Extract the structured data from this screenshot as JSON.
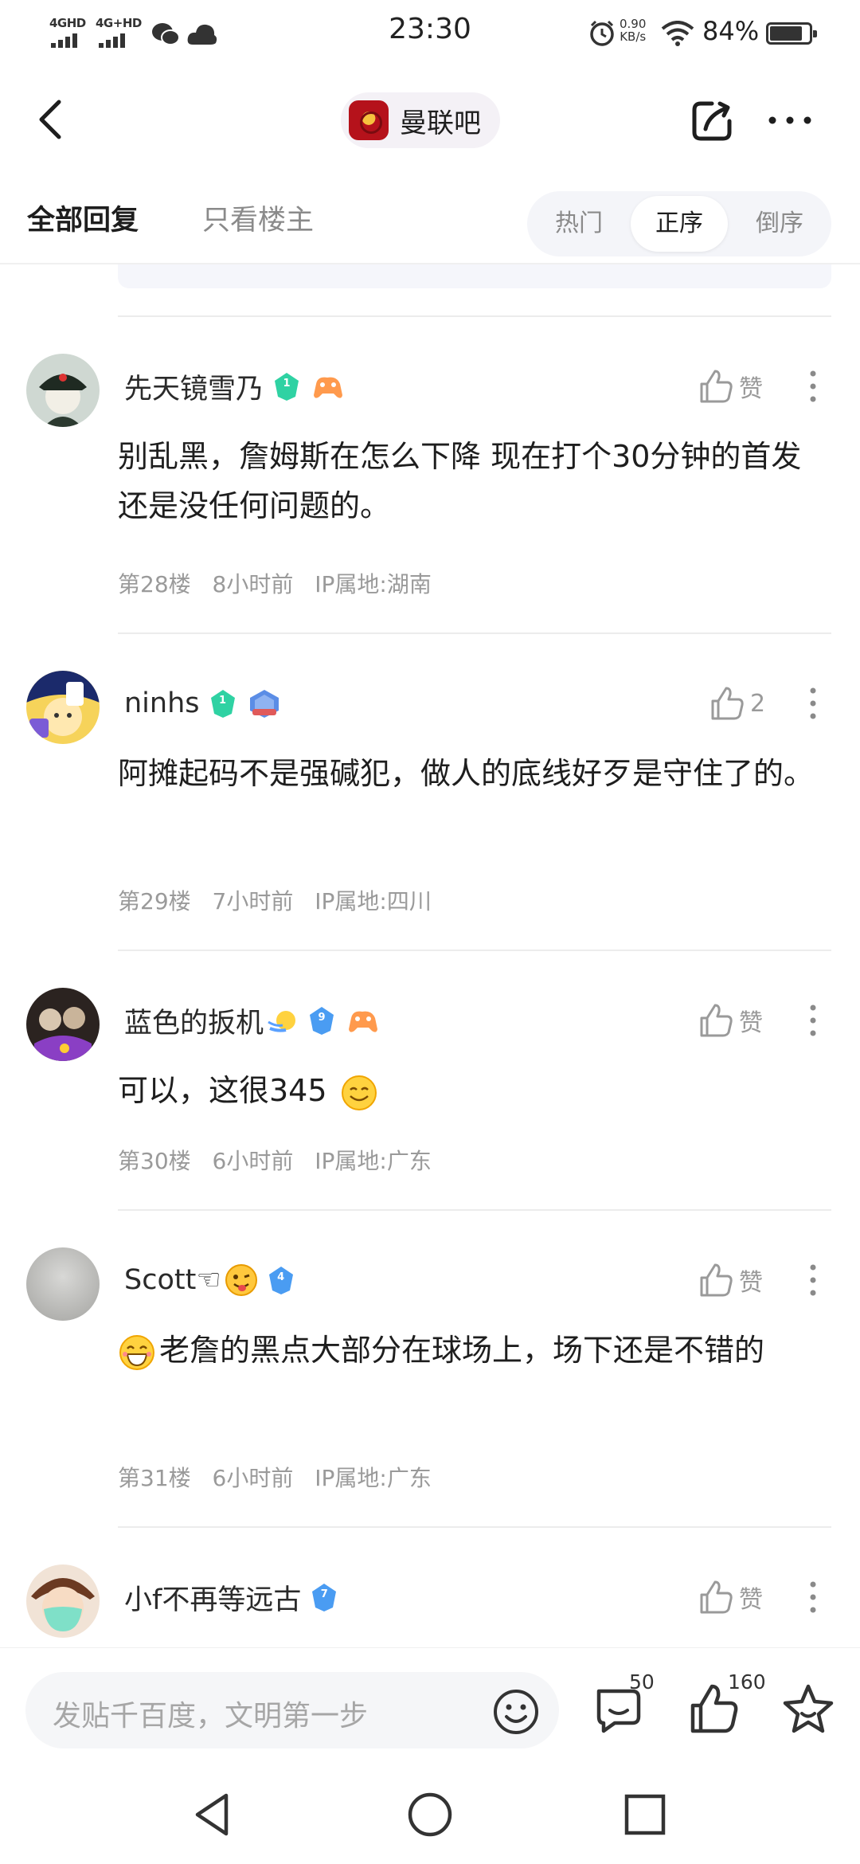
{
  "status_bar": {
    "sim1": "4GHD",
    "sim2": "4G+HD",
    "time": "23:30",
    "net_speed_value": "0.90",
    "net_speed_unit": "KB/s",
    "battery_pct": "84%",
    "battery_level": 0.84
  },
  "header": {
    "forum_name": "曼联吧"
  },
  "tabs": {
    "all_replies": "全部回复",
    "op_only": "只看楼主",
    "sort": [
      "热门",
      "正序",
      "倒序"
    ],
    "sort_selected": "正序"
  },
  "comments": [
    {
      "username": "先天镜雪乃",
      "level": "1",
      "level_color": "#2fd2a3",
      "content": "别乱黑，詹姆斯在怎么下降 现在打个30分钟的首发还是没任何问题的。",
      "floor": "第28楼",
      "time": "8小时前",
      "ip": "IP属地:湖南",
      "like": "赞"
    },
    {
      "username": "ninhs",
      "level": "1",
      "level_color": "#2fd2a3",
      "content": "阿摊起码不是强碱犯，做人的底线好歹是守住了的。",
      "floor": "第29楼",
      "time": "7小时前",
      "ip": "IP属地:四川",
      "like": "2"
    },
    {
      "username": "蓝色的扳机",
      "level": "9",
      "level_color": "#4a9cf2",
      "content": "可以，这很345",
      "floor": "第30楼",
      "time": "6小时前",
      "ip": "IP属地:广东",
      "like": "赞"
    },
    {
      "username": "Scott☜",
      "level": "4",
      "level_color": "#4a9cf2",
      "content": "老詹的黑点大部分在球场上，场下还是不错的",
      "floor": "第31楼",
      "time": "6小时前",
      "ip": "IP属地:广东",
      "like": "赞"
    },
    {
      "username": "小f不再等远古",
      "level": "7",
      "level_color": "#4a9cf2",
      "like": "赞"
    }
  ],
  "bottom_bar": {
    "input_placeholder": "发贴千百度，文明第一步",
    "reply_count": "50",
    "like_count": "160"
  },
  "icons": {
    "back": "back-arrow-icon",
    "share": "share-icon",
    "more": "more-icon",
    "like": "thumb-up-icon",
    "reply": "comment-icon",
    "favorite": "star-icon",
    "emoji": "smiley-icon"
  }
}
